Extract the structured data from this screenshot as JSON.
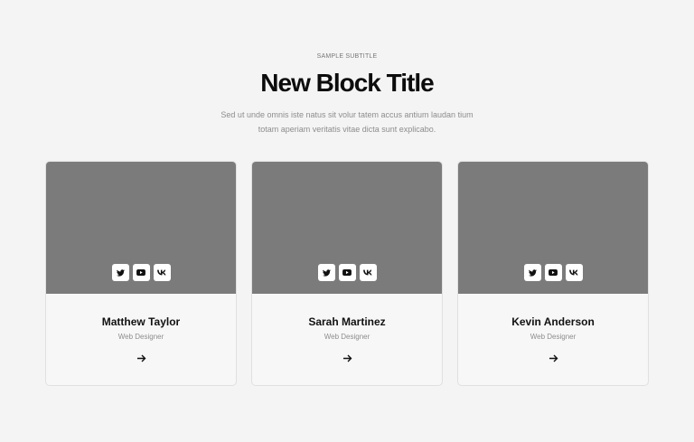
{
  "section": {
    "subtitle": "SAMPLE SUBTITLE",
    "title": "New Block Title",
    "description": "Sed ut unde omnis iste natus sit volur tatem accus antium laudan tium totam aperiam veritatis vitae dicta sunt explicabo."
  },
  "team": [
    {
      "name": "Matthew Taylor",
      "role": "Web Designer"
    },
    {
      "name": "Sarah Martinez",
      "role": "Web Designer"
    },
    {
      "name": "Kevin Anderson",
      "role": "Web Designer"
    }
  ],
  "social_icons": [
    "twitter-icon",
    "youtube-icon",
    "vk-icon"
  ],
  "colors": {
    "background": "#f4f4f4",
    "card_image": "#7b7b7c",
    "card": "#f7f7f7"
  }
}
